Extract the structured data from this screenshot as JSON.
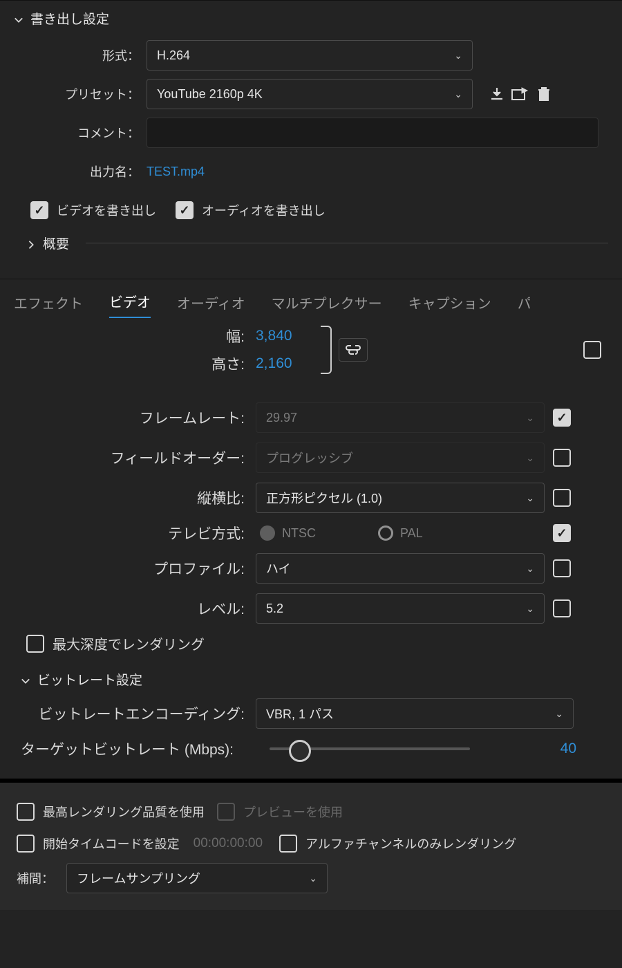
{
  "exportSettings": {
    "title": "書き出し設定",
    "formatLabel": "形式：",
    "formatValue": "H.264",
    "presetLabel": "プリセット：",
    "presetValue": "YouTube 2160p 4K",
    "commentLabel": "コメント：",
    "commentValue": "",
    "outputNameLabel": "出力名：",
    "outputNameValue": "TEST.mp4",
    "exportVideoLabel": "ビデオを書き出し",
    "exportAudioLabel": "オーディオを書き出し",
    "summaryLabel": "概要"
  },
  "tabs": {
    "effects": "エフェクト",
    "video": "ビデオ",
    "audio": "オーディオ",
    "multiplexer": "マルチプレクサー",
    "caption": "キャプション",
    "trunc": "パ"
  },
  "video": {
    "widthLabel": "幅:",
    "widthValue": "3,840",
    "heightLabel": "高さ:",
    "heightValue": "2,160",
    "frameRateLabel": "フレームレート:",
    "frameRateValue": "29.97",
    "fieldOrderLabel": "フィールドオーダー:",
    "fieldOrderValue": "プログレッシブ",
    "aspectLabel": "縦横比:",
    "aspectValue": "正方形ピクセル (1.0)",
    "tvLabel": "テレビ方式:",
    "tvNtsc": "NTSC",
    "tvPal": "PAL",
    "profileLabel": "プロファイル:",
    "profileValue": "ハイ",
    "levelLabel": "レベル:",
    "levelValue": "5.2",
    "maxDepthLabel": "最大深度でレンダリング"
  },
  "bitrate": {
    "title": "ビットレート設定",
    "encodingLabel": "ビットレートエンコーディング:",
    "encodingValue": "VBR, 1 パス",
    "targetLabel": "ターゲットビットレート (Mbps):",
    "targetValue": "40"
  },
  "bottom": {
    "maxRenderQuality": "最高レンダリング品質を使用",
    "usePreview": "プレビューを使用",
    "setStartTimecode": "開始タイムコードを設定",
    "timecode": "00:00:00:00",
    "alphaOnly": "アルファチャンネルのみレンダリング",
    "interpLabel": "補間：",
    "interpValue": "フレームサンプリング"
  }
}
